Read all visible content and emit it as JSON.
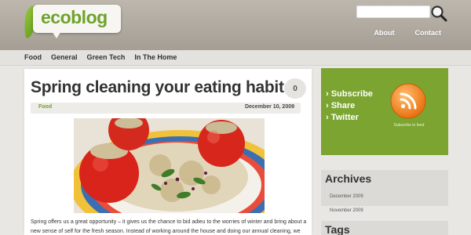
{
  "header": {
    "logo_text": "ecoblog",
    "search_placeholder": "",
    "nav": [
      "About",
      "Contact"
    ]
  },
  "categories": [
    "Food",
    "General",
    "Green Tech",
    "In The Home"
  ],
  "post": {
    "title": "Spring cleaning your eating habits",
    "comment_count": "0",
    "category": "Food",
    "date": "December 10, 2009",
    "excerpt": "Spring offers us a great opportunity – it gives us the chance to bid adieu to the worries of winter and bring about a new sense of self for the fresh season. Instead of working around the house and doing our annual cleaning, we should focus on cleaning"
  },
  "sidebar": {
    "subscribe_links": [
      "› Subscribe",
      "› Share",
      "› Twitter"
    ],
    "rss_label": "Subscribe to feed",
    "archives_title": "Archives",
    "archives": [
      "December 2009",
      "November 2009"
    ],
    "tags_title": "Tags"
  },
  "colors": {
    "brand_green": "#6ea32b",
    "subscribe_bg": "#7ba431",
    "rss_orange": "#f08a1d"
  },
  "icons": [
    "search-icon",
    "rss-icon",
    "leaf-icon"
  ]
}
